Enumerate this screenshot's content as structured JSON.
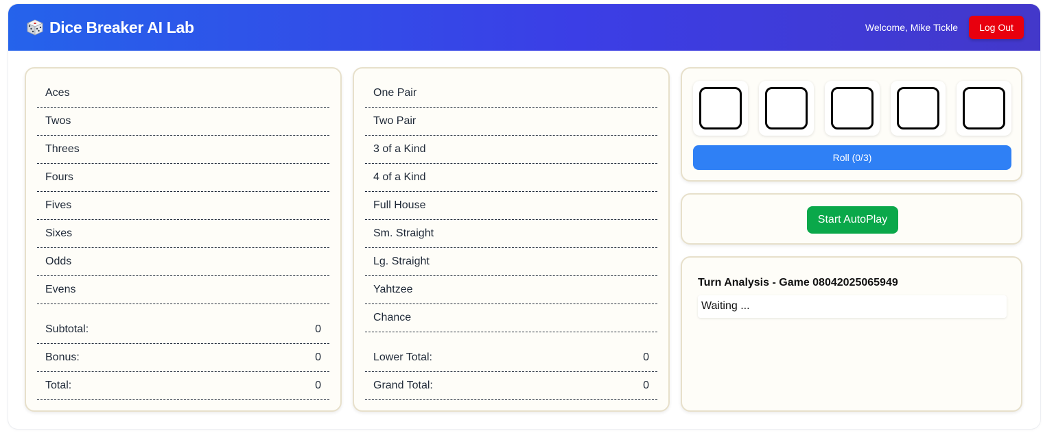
{
  "header": {
    "title": "Dice Breaker AI Lab",
    "icon": "dice-icon",
    "welcome": "Welcome, Mike Tickle",
    "logout_label": "Log Out"
  },
  "upper": {
    "rows": [
      {
        "label": "Aces"
      },
      {
        "label": "Twos"
      },
      {
        "label": "Threes"
      },
      {
        "label": "Fours"
      },
      {
        "label": "Fives"
      },
      {
        "label": "Sixes"
      },
      {
        "label": "Odds"
      },
      {
        "label": "Evens"
      }
    ],
    "totals": [
      {
        "label": "Subtotal:",
        "value": "0"
      },
      {
        "label": "Bonus:",
        "value": "0"
      },
      {
        "label": "Total:",
        "value": "0"
      }
    ]
  },
  "lower": {
    "rows": [
      {
        "label": "One Pair"
      },
      {
        "label": "Two Pair"
      },
      {
        "label": "3 of a Kind"
      },
      {
        "label": "4 of a Kind"
      },
      {
        "label": "Full House"
      },
      {
        "label": "Sm. Straight"
      },
      {
        "label": "Lg. Straight"
      },
      {
        "label": "Yahtzee"
      },
      {
        "label": "Chance"
      }
    ],
    "totals": [
      {
        "label": "Lower Total:",
        "value": "0"
      },
      {
        "label": "Grand Total:",
        "value": "0"
      }
    ]
  },
  "dice": {
    "roll_label": "Roll (0/3)"
  },
  "autoplay": {
    "label": "Start AutoPlay"
  },
  "analysis": {
    "title": "Turn Analysis - Game 08042025065949",
    "status": "Waiting ..."
  },
  "colors": {
    "header_start": "#2563eb",
    "header_end": "#4338ca",
    "logout": "#e8000e",
    "roll": "#2f80f5",
    "autoplay": "#0aa84a",
    "panel_bg": "#fefdf8",
    "panel_border": "#e7e0cb"
  }
}
